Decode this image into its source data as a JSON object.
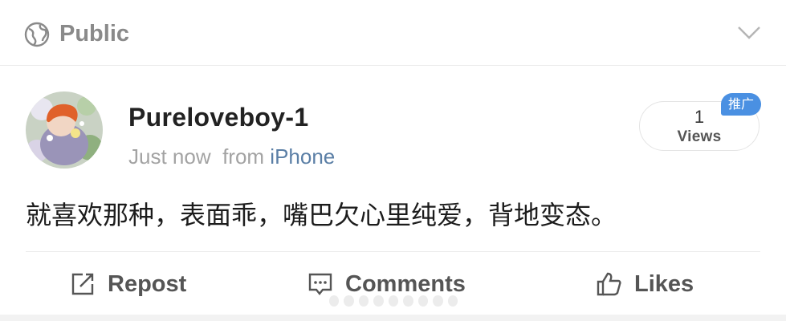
{
  "visibility": {
    "label": "Public",
    "icon": "globe-icon"
  },
  "post": {
    "username": "Pureloveboy-1",
    "timestamp": "Just now",
    "from_prefix": "from",
    "source": "iPhone",
    "text": "就喜欢那种，表面乖，嘴巴欠心里纯爱，背地变态。"
  },
  "views": {
    "count": "1",
    "label": "Views",
    "badge": "推广"
  },
  "actions": {
    "repost": "Repost",
    "comments": "Comments",
    "likes": "Likes"
  },
  "colors": {
    "accent": "#4a90e2",
    "source_link": "#5b7fa6",
    "muted": "#a3a3a3"
  }
}
